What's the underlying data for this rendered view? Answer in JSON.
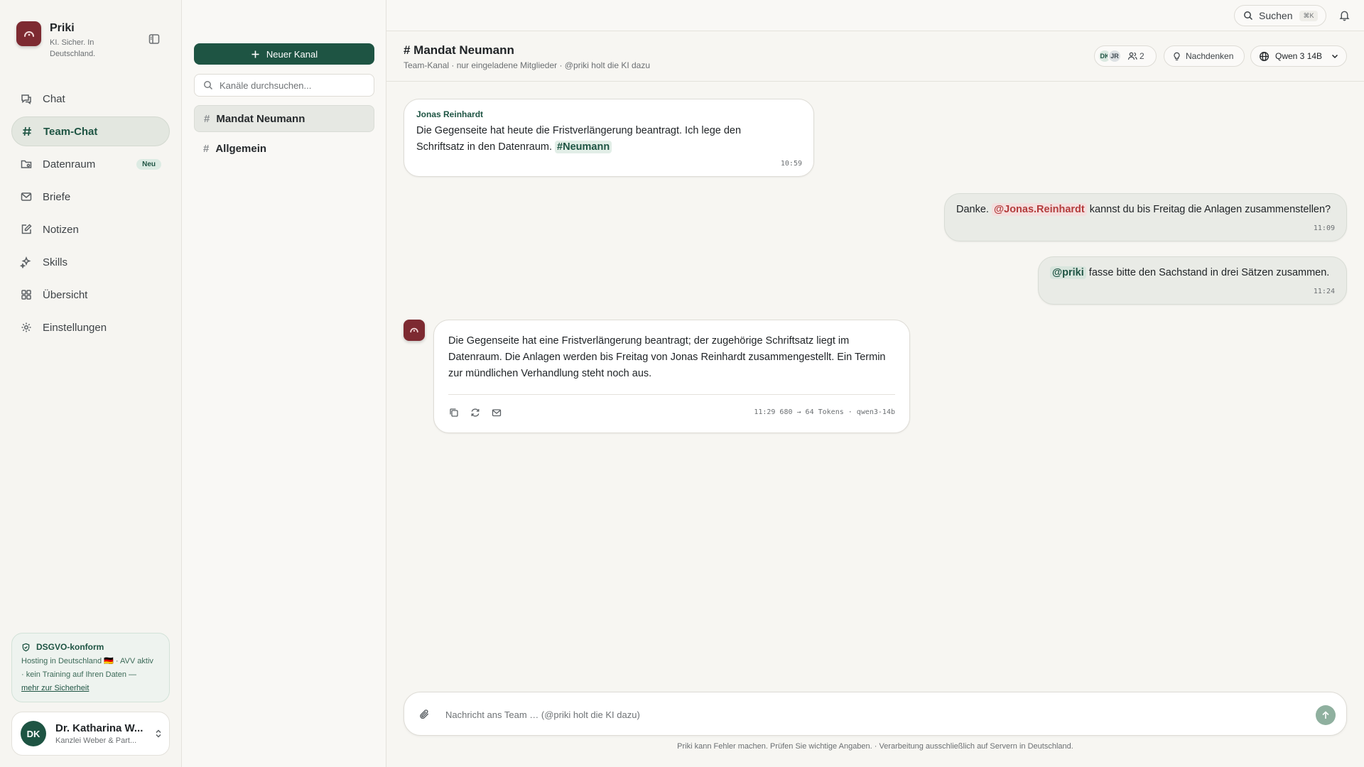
{
  "brand": {
    "name": "Priki",
    "tagline": "KI. Sicher. In Deutschland."
  },
  "nav": [
    {
      "label": "Chat",
      "icon": "chat-icon"
    },
    {
      "label": "Team-Chat",
      "icon": "hash-icon",
      "active": true
    },
    {
      "label": "Datenraum",
      "icon": "folder-icon",
      "badge": "Neu"
    },
    {
      "label": "Briefe",
      "icon": "mail-icon"
    },
    {
      "label": "Notizen",
      "icon": "note-icon"
    },
    {
      "label": "Skills",
      "icon": "sparkles-icon"
    },
    {
      "label": "Übersicht",
      "icon": "grid-icon"
    },
    {
      "label": "Einstellungen",
      "icon": "gear-icon"
    }
  ],
  "security": {
    "title": "DSGVO-konform",
    "line1": "Hosting in Deutschland 🇩🇪 · AVV aktiv",
    "line2": "· kein Training auf Ihren Daten —",
    "link": "mehr zur Sicherheit"
  },
  "user": {
    "initials": "DK",
    "name": "Dr. Katharina W...",
    "org": "Kanzlei Weber & Part..."
  },
  "channels": {
    "new_button": "Neuer Kanal",
    "search_placeholder": "Kanäle durchsuchen...",
    "items": [
      {
        "name": "Mandat Neumann",
        "active": true
      },
      {
        "name": "Allgemein",
        "active": false
      }
    ]
  },
  "topbar": {
    "search_label": "Suchen",
    "shortcut": "⌘K"
  },
  "header": {
    "title": "# Mandat Neumann",
    "subtitle": "Team-Kanal · nur eingeladene Mitglieder · @priki holt die KI dazu",
    "member_initials": [
      "DK",
      "JR"
    ],
    "member_count": "2",
    "think_label": "Nachdenken",
    "model_label": "Qwen 3 14B"
  },
  "messages": {
    "m1": {
      "sender": "Jonas Reinhardt",
      "line1": "Die Gegenseite hat heute die Fristverlängerung beantragt. Ich lege den",
      "line2_pre": "Schriftsatz in den Datenraum.",
      "tag": "#Neumann",
      "time": "10:59"
    },
    "m2": {
      "pre": "Danke.",
      "mention": "@Jonas.Reinhardt",
      "post": "kannst du bis Freitag die Anlagen zusammenstellen?",
      "time": "11:09"
    },
    "m3": {
      "mention": "@priki",
      "post": "fasse bitte den Sachstand in drei Sätzen zusammen.",
      "time": "11:24"
    },
    "ai": {
      "line1": "Die Gegenseite hat eine Fristverlängerung beantragt; der zugehörige Schriftsatz liegt im",
      "line2": "Datenraum. Die Anlagen werden bis Freitag von Jonas Reinhardt zusammengestellt. Ein Termin",
      "line3": "zur mündlichen Verhandlung steht noch aus.",
      "meta": "11:29 680 → 64 Tokens · qwen3-14b"
    }
  },
  "composer": {
    "placeholder": "Nachricht ans Team … (@priki holt die KI dazu)"
  },
  "disclaimer": "Priki kann Fehler machen. Prüfen Sie wichtige Angaben. · Verarbeitung ausschließlich auf Servern in Deutschland.",
  "colors": {
    "accent": "#1e5443",
    "brand": "#7d2a31",
    "mention_red": "#b33c3c"
  }
}
